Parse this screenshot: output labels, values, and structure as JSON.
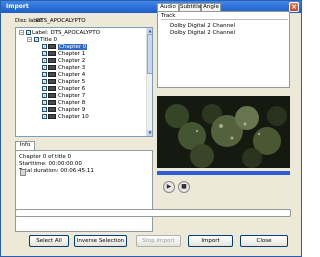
{
  "window": {
    "title": "Import",
    "close": "×"
  },
  "disc": {
    "label": "Disc label:",
    "value": "DTS_APOCALYPTO"
  },
  "tree": {
    "root_label": "Label: DTS_APOCALYPTO",
    "title_label": "Title 0",
    "chapters": [
      "Chapter 0",
      "Chapter 1",
      "Chapter 2",
      "Chapter 3",
      "Chapter 4",
      "Chapter 5",
      "Chapter 6",
      "Chapter 7",
      "Chapter 8",
      "Chapter 9",
      "Chapter 10"
    ],
    "selected_index": 0
  },
  "info_tab": "Info",
  "info": {
    "line1": "Chapter 0 of title 0",
    "line2": "Starttime: 00:00:00.00",
    "line3": "Total duration: 00:06:45:11"
  },
  "media_tabs": [
    "Audio",
    "Subtitle",
    "Angle"
  ],
  "tracks": {
    "header": "Track",
    "items": [
      "Dolby Digital 2 Channel",
      "Dolby Digital 2 Channel"
    ]
  },
  "player": {
    "play": "▶",
    "stop": "■"
  },
  "buttons": {
    "select_all": "Select All",
    "inverse_selection": "Inverse Selection",
    "stop_import": "Stop Import",
    "import": "Import",
    "close": "Close"
  }
}
